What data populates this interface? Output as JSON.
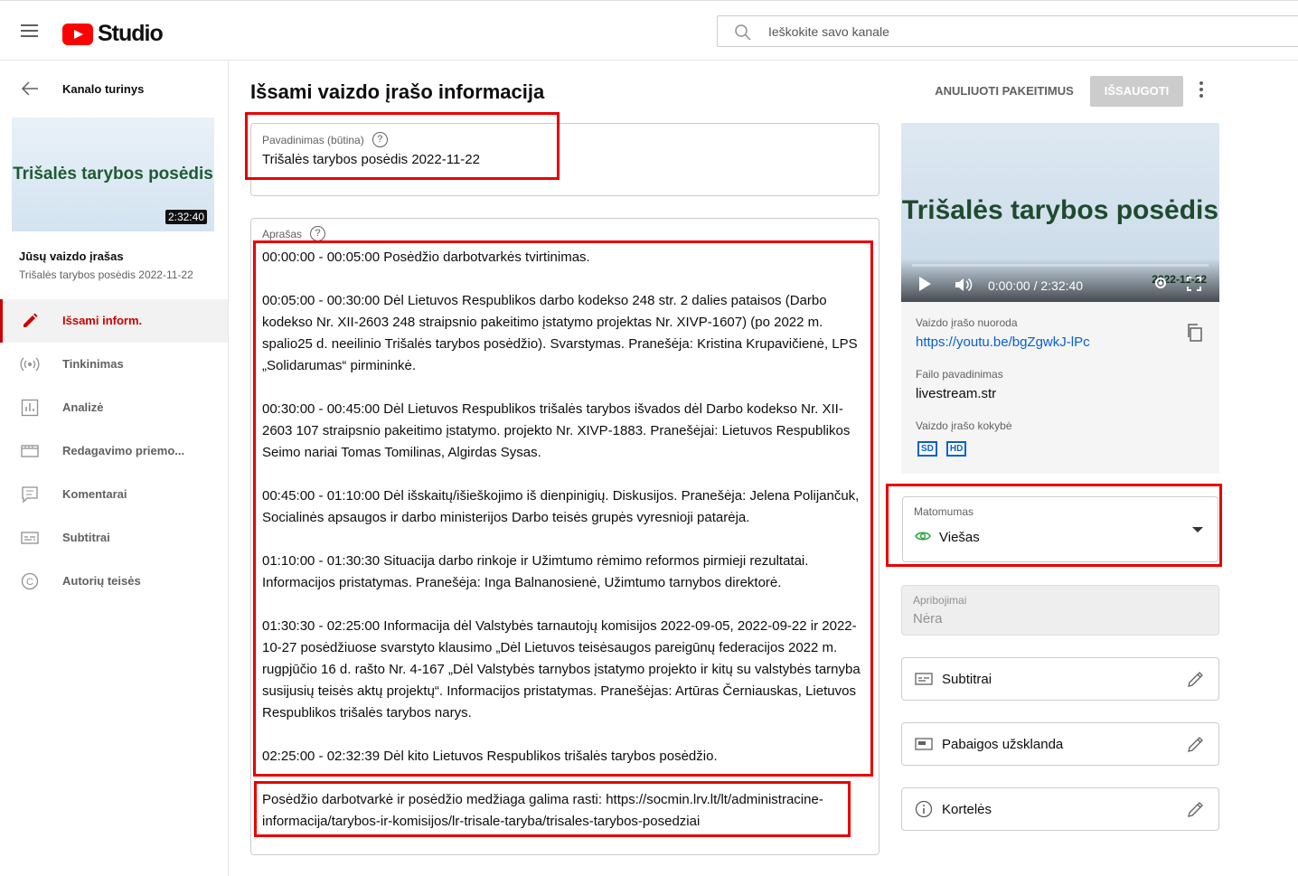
{
  "header": {
    "logo_text": "Studio",
    "search_placeholder": "Ieškokite savo kanale"
  },
  "sidebar": {
    "back_label": "Kanalo turinys",
    "thumbnail_title": "Trišalės tarybos posėdis",
    "thumbnail_duration": "2:32:40",
    "your_video_label": "Jūsų vaizdo įrašas",
    "video_title": "Trišalės tarybos posėdis 2022-11-22",
    "nav": [
      {
        "label": "Išsami inform.",
        "icon": "pencil-icon",
        "active": true
      },
      {
        "label": "Tinkinimas",
        "icon": "broadcast-icon",
        "active": false
      },
      {
        "label": "Analizė",
        "icon": "analytics-icon",
        "active": false
      },
      {
        "label": "Redagavimo priemo...",
        "icon": "editor-icon",
        "active": false
      },
      {
        "label": "Komentarai",
        "icon": "comments-icon",
        "active": false
      },
      {
        "label": "Subtitrai",
        "icon": "subtitles-icon",
        "active": false
      },
      {
        "label": "Autorių teisės",
        "icon": "copyright-icon",
        "active": false
      }
    ]
  },
  "main": {
    "page_title": "Išsami vaizdo įrašo informacija",
    "undo_label": "ANULIUOTI PAKEITIMUS",
    "save_label": "IŠSAUGOTI",
    "title_field": {
      "label": "Pavadinimas (būtina)",
      "value": "Trišalės tarybos posėdis 2022-11-22"
    },
    "description_field": {
      "label": "Aprašas",
      "paragraphs": [
        "00:00:00 - 00:05:00 Posėdžio darbotvarkės tvirtinimas.",
        "00:05:00 - 00:30:00 Dėl Lietuvos Respublikos darbo kodekso 248 str. 2 dalies pataisos (Darbo kodekso Nr. XII-2603 248 straipsnio pakeitimo įstatymo projektas Nr. XIVP-1607) (po 2022 m. spalio25 d. neeilinio Trišalės tarybos posėdžio). Svarstymas. Pranešėja: Kristina Krupavičienė, LPS „Solidarumas“ pirmininkė.",
        "00:30:00 - 00:45:00 Dėl Lietuvos Respublikos trišalės tarybos išvados dėl Darbo kodekso Nr. XII-2603 107 straipsnio pakeitimo įstatymo. projekto Nr. XIVP-1883. Pranešėjai: Lietuvos Respublikos Seimo nariai Tomas Tomilinas, Algirdas Sysas.",
        "00:45:00 - 01:10:00 Dėl išskaitų/išieškojimo iš dienpinigių. Diskusijos. Pranešėja: Jelena Polijančuk, Socialinės apsaugos ir darbo ministerijos Darbo teisės grupės vyresnioji patarėja.",
        "01:10:00 - 01:30:30 Situacija darbo rinkoje ir Užimtumo rėmimo reformos pirmieji rezultatai. Informacijos pristatymas. Pranešėja: Inga Balnanosienė, Užimtumo tarnybos direktorė.",
        "01:30:30 - 02:25:00 Informacija dėl Valstybės tarnautojų komisijos 2022-09-05, 2022-09-22 ir 2022-10-27 posėdžiuose svarstyto klausimo „Dėl Lietuvos teisėsaugos pareigūnų federacijos 2022 m. rugpjūčio 16 d. rašto Nr. 4-167 „Dėl Valstybės tarnybos įstatymo projekto ir kitų su valstybės tarnyba susijusių teisės aktų projektų“. Informacijos pristatymas. Pranešėjas: Artūras Černiauskas, Lietuvos Respublikos trišalės tarybos narys.",
        "02:25:00 - 02:32:39 Dėl kito Lietuvos Respublikos trišalės tarybos posėdžio.",
        "Posėdžio darbotvarkė ir posėdžio medžiaga galima rasti: https://socmin.lrv.lt/lt/administracine-informacija/tarybos-ir-komisijos/lr-trisale-taryba/trisales-tarybos-posedziai"
      ]
    }
  },
  "preview": {
    "video_title": "Trišalės tarybos posėdis",
    "video_date": "2022-11-22",
    "time": "0:00:00 / 2:32:40",
    "link_label": "Vaizdo įrašo nuoroda",
    "link_url": "https://youtu.be/bgZgwkJ-lPc",
    "filename_label": "Failo pavadinimas",
    "filename": "livestream.str",
    "quality_label": "Vaizdo įrašo kokybė",
    "quality_badges": [
      "SD",
      "HD"
    ]
  },
  "visibility": {
    "label": "Matomumas",
    "value": "Viešas",
    "eye_color": "#2ba640"
  },
  "restrictions": {
    "label": "Apribojimai",
    "value": "Nėra"
  },
  "actions": [
    {
      "label": "Subtitrai",
      "icon": "subtitles-icon"
    },
    {
      "label": "Pabaigos užsklanda",
      "icon": "end-screen-icon"
    },
    {
      "label": "Kortelės",
      "icon": "info-icon"
    }
  ],
  "colors": {
    "accent_red": "#cc0000",
    "highlight_red": "#e80000",
    "link_blue": "#065fd4"
  }
}
